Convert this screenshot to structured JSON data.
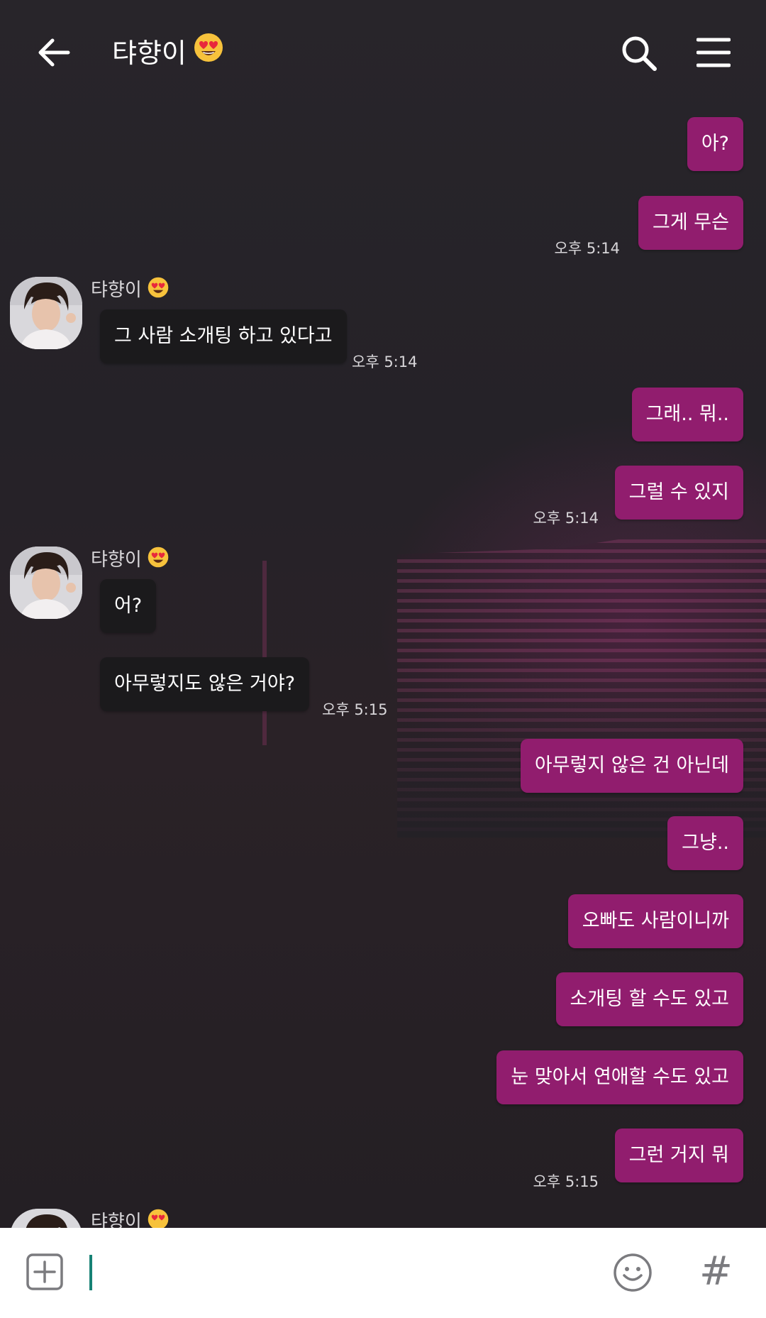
{
  "header": {
    "title": "탸향이",
    "title_emoji": "heart-eyes-emoji",
    "back_icon": "arrow-left-icon",
    "search_icon": "search-icon",
    "menu_icon": "menu-icon"
  },
  "messages": [
    {
      "side": "out",
      "text": "아?"
    },
    {
      "side": "out",
      "text": "그게 무슨",
      "time": "오후 5:14"
    },
    {
      "side": "in",
      "sender": "탸향이",
      "text": "그 사람 소개팅 하고 있다고",
      "time": "오후 5:14"
    },
    {
      "side": "out",
      "text": "그래.. 뭐.."
    },
    {
      "side": "out",
      "text": "그럴 수 있지",
      "time": "오후 5:14"
    },
    {
      "side": "in",
      "sender": "탸향이",
      "text": "어?"
    },
    {
      "side": "in",
      "text": "아무렇지도 않은 거야?",
      "time": "오후 5:15"
    },
    {
      "side": "out",
      "text": "아무렇지 않은 건 아닌데"
    },
    {
      "side": "out",
      "text": "그냥.."
    },
    {
      "side": "out",
      "text": "오빠도 사람이니까"
    },
    {
      "side": "out",
      "text": "소개팅 할 수도 있고"
    },
    {
      "side": "out",
      "text": "눈 맞아서 연애할 수도 있고"
    },
    {
      "side": "out",
      "text": "그런 거지 뭐",
      "time": "오후 5:15"
    },
    {
      "side": "in",
      "sender": "탸향이"
    }
  ],
  "input": {
    "value": "",
    "plus_icon": "plus-box-icon",
    "emoji_icon": "smiley-icon",
    "hash_label": "#"
  },
  "colors": {
    "outgoing_bubble": "#911d6e",
    "incoming_bubble": "#1b1a1c",
    "caret": "#178275"
  }
}
